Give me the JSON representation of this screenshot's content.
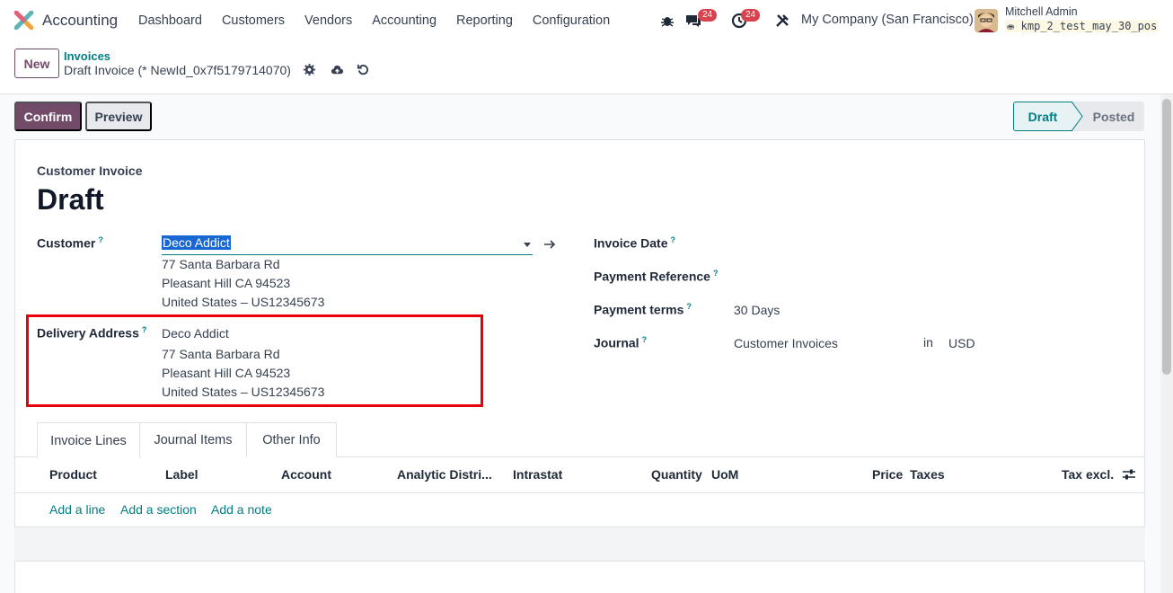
{
  "navbar": {
    "app_name": "Accounting",
    "menu": [
      "Dashboard",
      "Customers",
      "Vendors",
      "Accounting",
      "Reporting",
      "Configuration"
    ],
    "messages_badge": "24",
    "activity_badge": "24",
    "company": "My Company (San Francisco)",
    "user_name": "Mitchell Admin",
    "db_name": "kmp_2_test_may_30_pos"
  },
  "control_panel": {
    "new_label": "New",
    "breadcrumb_parent": "Invoices",
    "breadcrumb_current": "Draft Invoice (* NewId_0x7f5179714070)"
  },
  "statusbar": {
    "confirm_label": "Confirm",
    "preview_label": "Preview",
    "stages": [
      "Draft",
      "Posted"
    ]
  },
  "form": {
    "doc_type": "Customer Invoice",
    "title": "Draft",
    "customer_label": "Customer",
    "customer_value": "Deco Addict",
    "customer_address": [
      "77 Santa Barbara Rd",
      "Pleasant Hill CA 94523",
      "United States – US12345673"
    ],
    "delivery_label": "Delivery Address",
    "delivery_address": [
      "Deco Addict",
      "77 Santa Barbara Rd",
      "Pleasant Hill CA 94523",
      "United States – US12345673"
    ],
    "invoice_date_label": "Invoice Date",
    "payment_ref_label": "Payment Reference",
    "payment_terms_label": "Payment terms",
    "payment_terms_value": "30 Days",
    "journal_label": "Journal",
    "journal_value": "Customer Invoices",
    "journal_in": "in",
    "currency": "USD",
    "tooltip_mark": "?"
  },
  "tabs": [
    "Invoice Lines",
    "Journal Items",
    "Other Info"
  ],
  "lines_table": {
    "columns": [
      "Product",
      "Label",
      "Account",
      "Analytic Distri...",
      "Intrastat",
      "Quantity",
      "UoM",
      "Price",
      "Taxes",
      "Tax excl."
    ],
    "add_links": [
      "Add a line",
      "Add a section",
      "Add a note"
    ]
  }
}
